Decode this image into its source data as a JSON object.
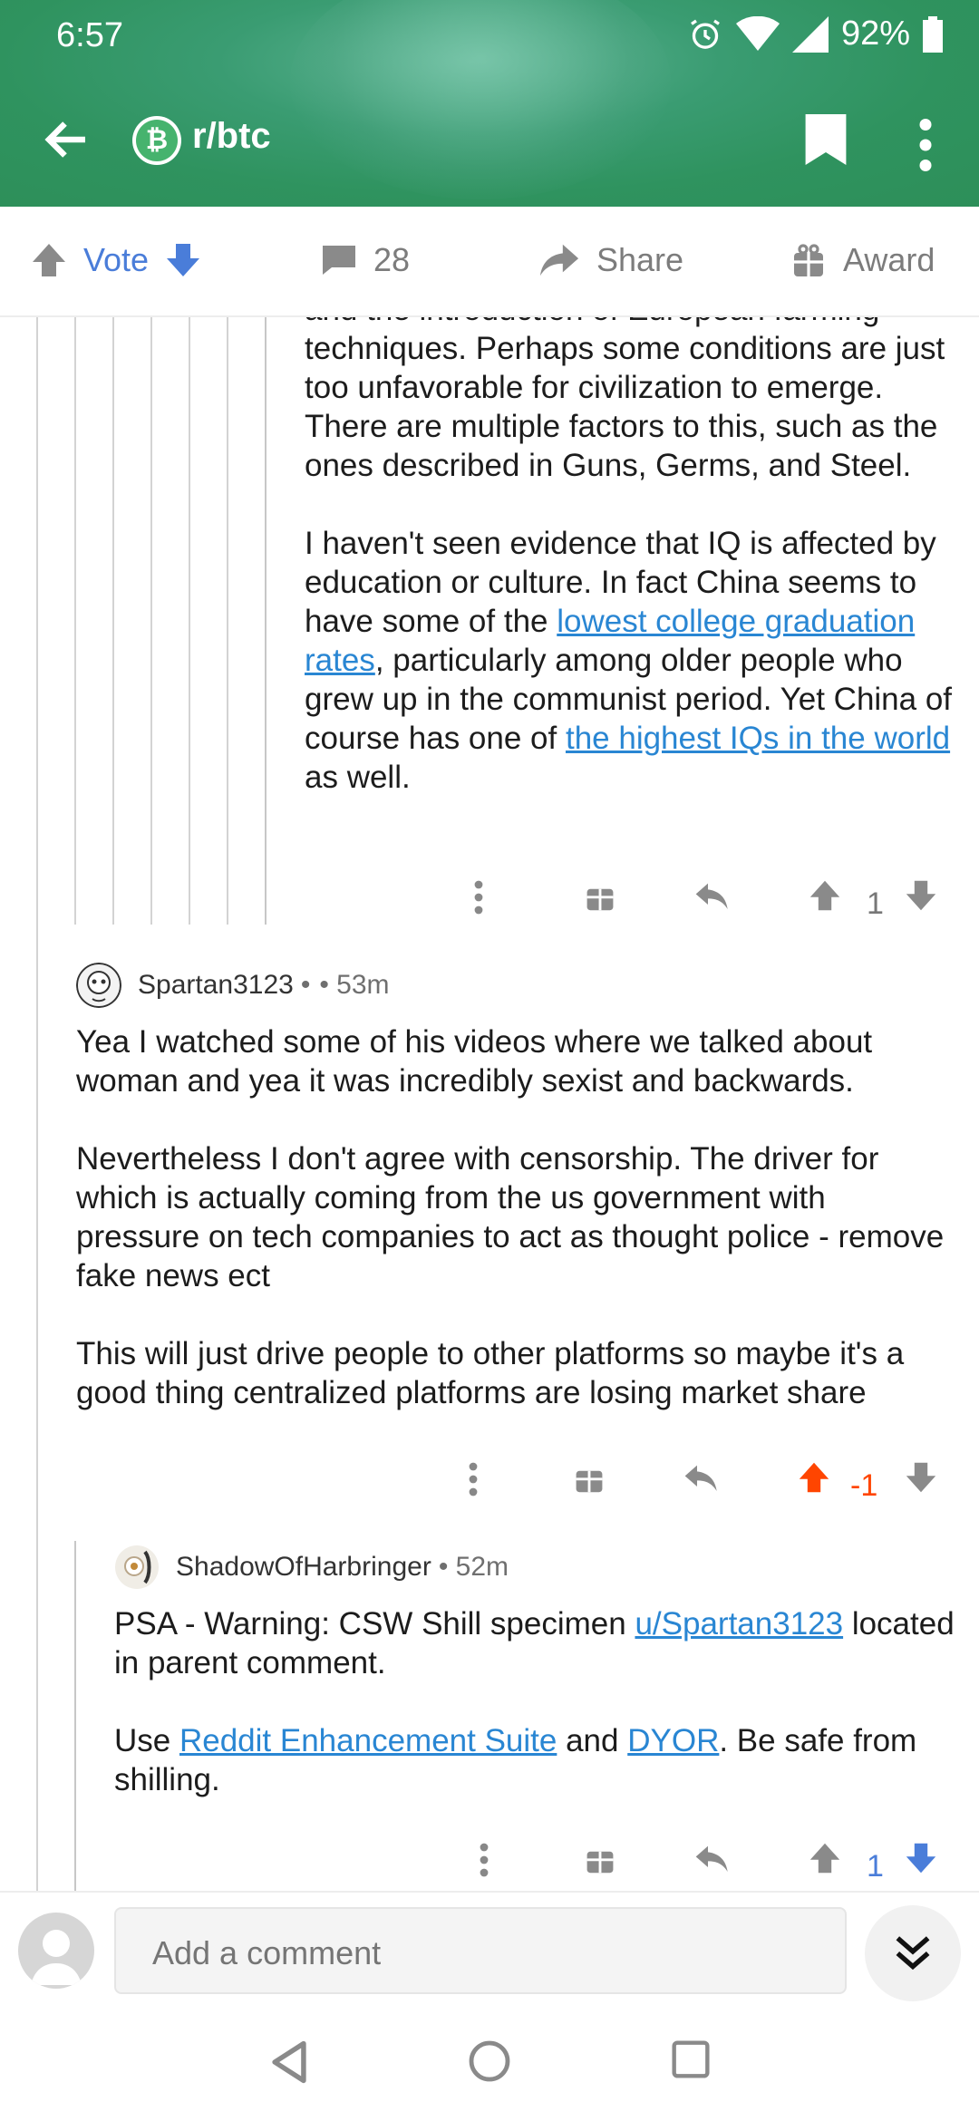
{
  "status_bar": {
    "time": "6:57",
    "battery": "92%",
    "icons": [
      "alarm-icon",
      "wifi-icon",
      "signal-icon",
      "battery-icon"
    ]
  },
  "nav": {
    "subreddit": "r/btc",
    "sub_icon_glyph": "₿"
  },
  "action_bar": {
    "vote_label": "Vote",
    "comment_count": "28",
    "share_label": "Share",
    "award_label": "Award"
  },
  "comments": [
    {
      "paragraphs": [
        {
          "segments": [
            {
              "text": "and the introduction of European farming techniques. Perhaps some conditions are just too unfavorable for civilization to emerge. There are multiple factors to this, such as the ones described in Guns, Germs, and Steel."
            }
          ]
        },
        {
          "segments": [
            {
              "text": "I haven't seen evidence that IQ is affected by education or culture. In fact China seems to have some of the "
            },
            {
              "text": "lowest college graduation rates",
              "link": true
            },
            {
              "text": ", particularly among older people who grew up in the communist period. Yet China of course has one of "
            },
            {
              "text": "the highest IQs in the world",
              "link": true
            },
            {
              "text": " as well."
            }
          ]
        }
      ],
      "score": "1"
    },
    {
      "author": "Spartan3123",
      "separator": "•",
      "age": "• 53m",
      "paragraphs": [
        "Yea I watched some of his videos where we talked about woman and yea it was incredibly sexist and backwards.",
        "Nevertheless I don't agree with censorship. The driver for which is actually coming from the us government with pressure on tech companies to act as thought police - remove fake news ect",
        "This will just drive people to other platforms so maybe it's a good thing centralized platforms are losing market share"
      ],
      "score": "-1"
    },
    {
      "author": "ShadowOfHarbringer",
      "age": "• 52m",
      "p1_pre": "PSA - Warning: CSW Shill specimen ",
      "p1_link": "u/Spartan3123",
      "p1_post": " located in parent comment.",
      "p2_pre": "Use ",
      "p2_link1": "Reddit Enhancement Suite",
      "p2_mid": " and ",
      "p2_link2": "DYOR",
      "p2_post": ". Be safe from shilling.",
      "score": "1"
    }
  ],
  "comment_bar": {
    "placeholder": "Add a comment"
  },
  "colors": {
    "header_green": "#2f935f",
    "link_blue": "#2986d3",
    "upvote_orange": "#ff4500",
    "downvote_blue": "#4a7dd9",
    "vote_label_blue": "#4a7dd9"
  }
}
